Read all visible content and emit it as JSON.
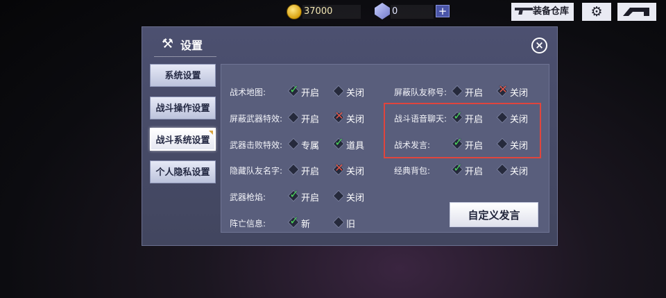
{
  "topbar": {
    "coin_value": "37000",
    "gem_value": "0",
    "plus_label": "+",
    "arsenal_label": "装备仓库",
    "settings_glyph": "⚙"
  },
  "dialog": {
    "title": "设置",
    "close_glyph": "×"
  },
  "tabs": [
    {
      "label": "系统设置",
      "active": false
    },
    {
      "label": "战斗操作设置",
      "active": false
    },
    {
      "label": "战斗系统设置",
      "active": true
    },
    {
      "label": "个人隐私设置",
      "active": false
    }
  ],
  "settings_left": [
    {
      "label": "战术地图:",
      "opt1": "开启",
      "opt1_state": "checked",
      "opt2": "关闭",
      "opt2_state": "empty"
    },
    {
      "label": "屏蔽武器特效:",
      "opt1": "开启",
      "opt1_state": "empty",
      "opt2": "关闭",
      "opt2_state": "crossed"
    },
    {
      "label": "武器击败特效:",
      "opt1": "专属",
      "opt1_state": "empty",
      "opt2": "道具",
      "opt2_state": "checked"
    },
    {
      "label": "隐藏队友名字:",
      "opt1": "开启",
      "opt1_state": "empty",
      "opt2": "关闭",
      "opt2_state": "crossed"
    },
    {
      "label": "武器枪焰:",
      "opt1": "开启",
      "opt1_state": "checked",
      "opt2": "关闭",
      "opt2_state": "empty"
    },
    {
      "label": "阵亡信息:",
      "opt1": "新",
      "opt1_state": "checked",
      "opt2": "旧",
      "opt2_state": "empty"
    }
  ],
  "settings_right": [
    {
      "label": "屏蔽队友称号:",
      "opt1": "开启",
      "opt1_state": "empty",
      "opt2": "关闭",
      "opt2_state": "crossed"
    },
    {
      "label": "战斗语音聊天:",
      "opt1": "开启",
      "opt1_state": "checked",
      "opt2": "关闭",
      "opt2_state": "empty"
    },
    {
      "label": "战术发言:",
      "opt1": "开启",
      "opt1_state": "checked",
      "opt2": "关闭",
      "opt2_state": "empty"
    },
    {
      "label": "经典背包:",
      "opt1": "开启",
      "opt1_state": "checked",
      "opt2": "关闭",
      "opt2_state": "empty"
    }
  ],
  "custom_speech_label": "自定义发言",
  "colors": {
    "check": "#4ed35a",
    "cross": "#e1574a",
    "highlight": "#e0453d"
  }
}
